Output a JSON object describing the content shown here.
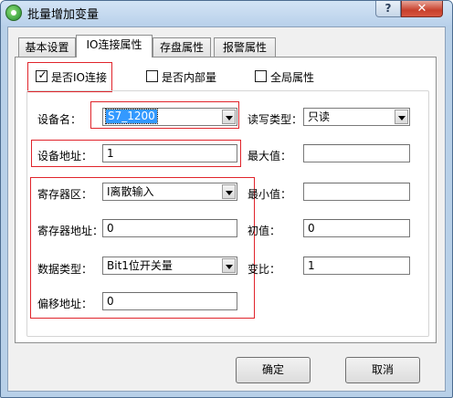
{
  "window": {
    "title": "批量增加变量",
    "help_label": "?",
    "close_label": "✕"
  },
  "tabs": [
    {
      "label": "基本设置",
      "active": false
    },
    {
      "label": "IO连接属性",
      "active": true
    },
    {
      "label": "存盘属性",
      "active": false
    },
    {
      "label": "报警属性",
      "active": false
    }
  ],
  "checkboxes": {
    "io_connect": {
      "label": "是否IO连接",
      "checked": true,
      "mark": "✓"
    },
    "internal": {
      "label": "是否内部量",
      "checked": false
    },
    "global": {
      "label": "全局属性",
      "checked": false
    }
  },
  "form": {
    "device_name": {
      "label": "设备名：",
      "value": "S7_1200"
    },
    "device_address": {
      "label": "设备地址：",
      "value": "1"
    },
    "register_area": {
      "label": "寄存器区：",
      "value": "I离散输入"
    },
    "register_address": {
      "label": "寄存器地址：",
      "value": "0"
    },
    "data_type": {
      "label": "数据类型：",
      "value": "Bit1位开关量"
    },
    "offset_address": {
      "label": "偏移地址：",
      "value": "0"
    },
    "rw_type": {
      "label": "读写类型：",
      "value": "只读"
    },
    "max_value": {
      "label": "最大值：",
      "value": ""
    },
    "min_value": {
      "label": "最小值：",
      "value": ""
    },
    "initial_value": {
      "label": "初值：",
      "value": "0"
    },
    "ratio": {
      "label": "变比：",
      "value": "1"
    }
  },
  "buttons": {
    "ok": "确定",
    "cancel": "取消"
  },
  "colors": {
    "highlight_border": "#e0242b",
    "title_bar": "#c5daef",
    "close_button": "#c8402c"
  }
}
